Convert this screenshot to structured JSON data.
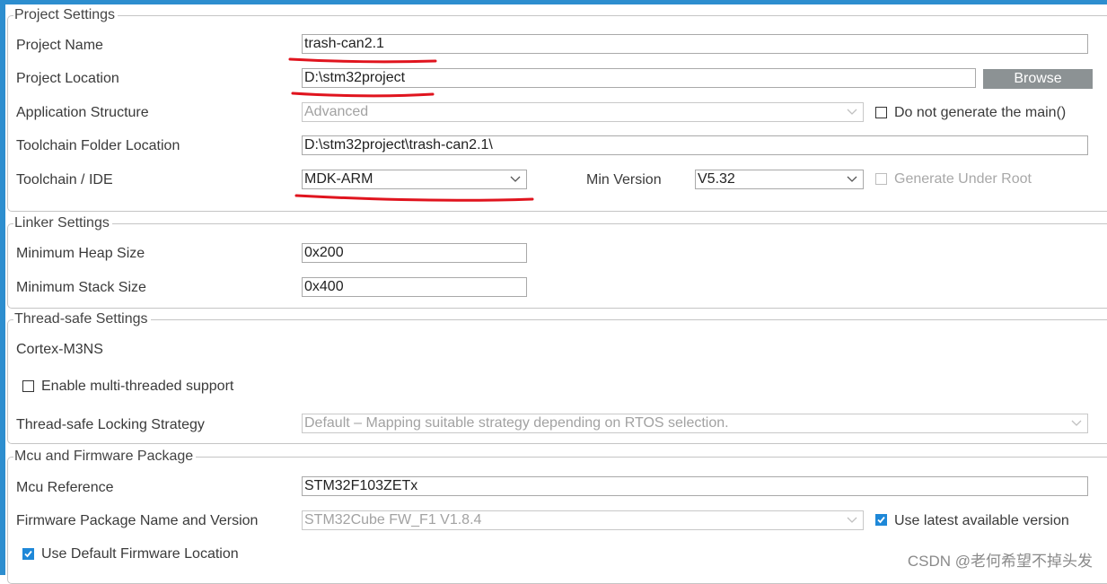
{
  "project_settings": {
    "legend": "Project Settings",
    "project_name_label": "Project Name",
    "project_name_value": "trash-can2.1",
    "project_location_label": "Project Location",
    "project_location_value": "D:\\stm32project",
    "browse_label": "Browse",
    "app_structure_label": "Application Structure",
    "app_structure_value": "Advanced",
    "do_not_generate_main_label": "Do not generate the main()",
    "toolchain_folder_label": "Toolchain Folder Location",
    "toolchain_folder_value": "D:\\stm32project\\trash-can2.1\\",
    "toolchain_ide_label": "Toolchain / IDE",
    "toolchain_ide_value": "MDK-ARM",
    "min_version_label": "Min Version",
    "min_version_value": "V5.32",
    "generate_under_root_label": "Generate Under Root"
  },
  "linker_settings": {
    "legend": "Linker Settings",
    "heap_label": "Minimum Heap Size",
    "heap_value": "0x200",
    "stack_label": "Minimum Stack Size",
    "stack_value": "0x400"
  },
  "thread_safe": {
    "legend": "Thread-safe Settings",
    "core_label": "Cortex-M3NS",
    "enable_mt_label": "Enable multi-threaded support",
    "locking_label": "Thread-safe Locking Strategy",
    "locking_value": "Default  –  Mapping suitable strategy depending on RTOS selection."
  },
  "mcu_firmware": {
    "legend": "Mcu and Firmware Package",
    "mcu_ref_label": "Mcu Reference",
    "mcu_ref_value": "STM32F103ZETx",
    "fw_label": "Firmware Package Name and Version",
    "fw_value": "STM32Cube FW_F1 V1.8.4",
    "use_latest_label": "Use latest available version",
    "use_default_fw_label": "Use Default Firmware Location"
  },
  "watermark": "CSDN @老何希望不掉头发",
  "colors": {
    "accent": "#2d8ecf",
    "checkbox_checked": "#1e88d8",
    "annotation": "#e0141e",
    "browse_button": "#8c9294"
  }
}
